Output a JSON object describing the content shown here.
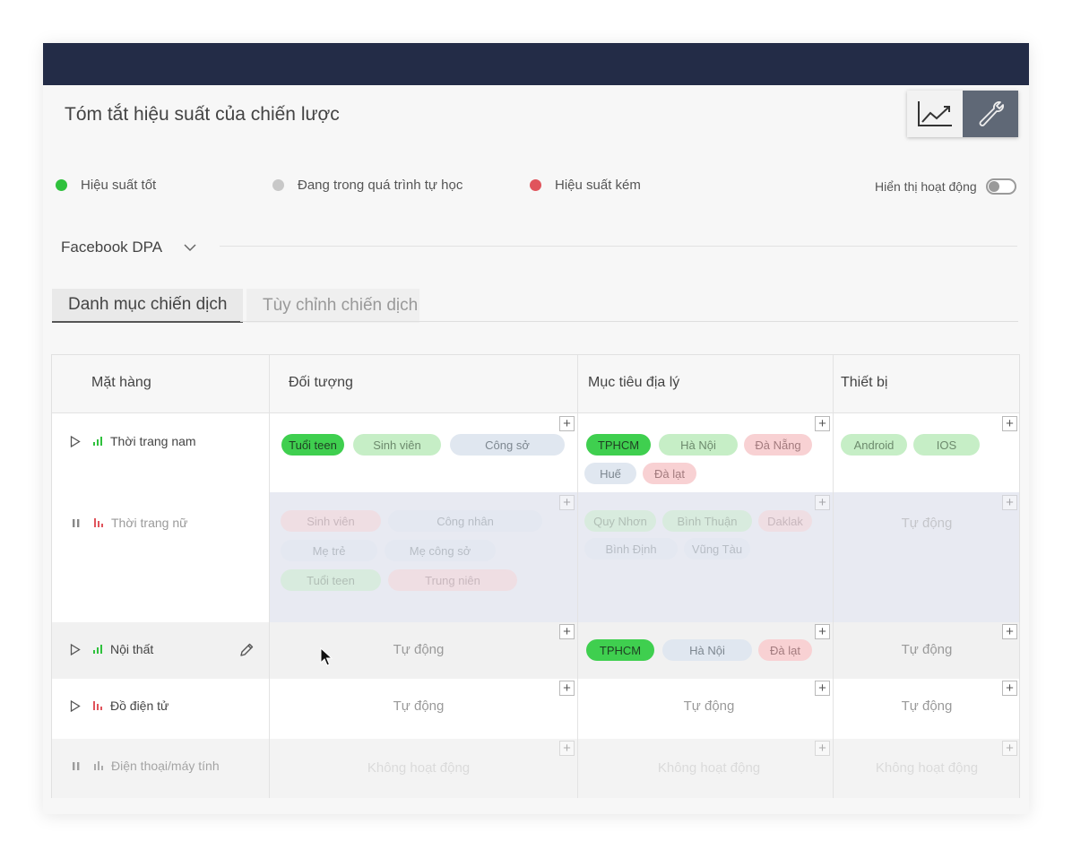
{
  "header": {
    "title": "Tóm tắt hiệu suất của chiến lược"
  },
  "view_toggle": {
    "chart_icon": "line-chart-icon",
    "tools_icon": "wrench-icon"
  },
  "legend": [
    {
      "label": "Hiệu suất tốt",
      "color": "#2fc13d"
    },
    {
      "label": "Đang trong quá trình tự học",
      "color": "#c8c8c8"
    },
    {
      "label": "Hiệu suất kém",
      "color": "#e0545c"
    }
  ],
  "activity_toggle": {
    "label": "Hiển thị hoạt động"
  },
  "platform": {
    "selected": "Facebook DPA"
  },
  "tabs": [
    {
      "label": "Danh mục chiến dịch"
    },
    {
      "label": "Tùy chỉnh chiến dịch"
    }
  ],
  "table": {
    "headers": {
      "product": "Mặt hàng",
      "audience": "Đối tượng",
      "geo": "Mục tiêu địa lý",
      "device": "Thiết bị"
    },
    "rows": [
      {
        "name": "Thời trang nam",
        "audience": [
          "Tuổi teen",
          "Sinh viên",
          "Công sở"
        ],
        "geo": [
          "TPHCM",
          "Hà Nội",
          "Đà Nẵng",
          "Huế",
          "Đà lạt"
        ],
        "device": [
          "Android",
          "IOS"
        ]
      },
      {
        "name": "Thời trang nữ",
        "audience": [
          "Sinh viên",
          "Công nhân",
          "Mẹ trẻ",
          "Mẹ công sở",
          "Tuổi teen",
          "Trung niên"
        ],
        "geo": [
          "Quy Nhơn",
          "Bình Thuận",
          "Daklak",
          "Bình Định",
          "Vũng Tàu"
        ],
        "device_text": "Tự động"
      },
      {
        "name": "Nội thất",
        "audience_text": "Tự động",
        "geo": [
          "TPHCM",
          "Hà Nội",
          "Đà lạt"
        ],
        "device_text": "Tự động"
      },
      {
        "name": "Đồ điện tử",
        "audience_text": "Tự động",
        "geo_text": "Tự động",
        "device_text": "Tự động"
      },
      {
        "name": "Điện thoại/máy tính",
        "audience_text": "Không hoạt động",
        "geo_text": "Không hoạt động",
        "device_text": "Không hoạt động"
      }
    ],
    "plus_label": "+"
  }
}
